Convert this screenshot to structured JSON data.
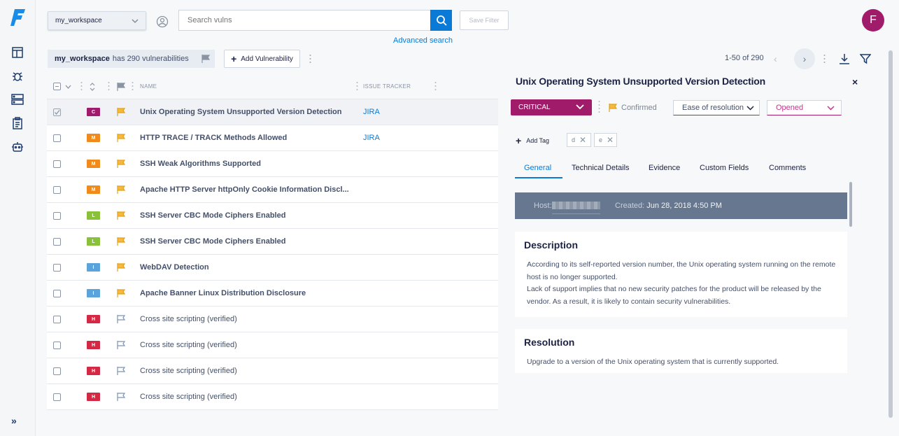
{
  "app": {
    "logo_letter": "F"
  },
  "nav": {
    "items": [
      "dashboard-icon",
      "bug-icon",
      "server-icon",
      "clipboard-icon",
      "robot-icon"
    ],
    "expand_label": "»"
  },
  "topbar": {
    "workspace": "my_workspace",
    "search_placeholder": "Search vulns",
    "save_filter": "Save Filter",
    "advanced_search": "Advanced search",
    "avatar_letter": "F"
  },
  "toolbar": {
    "workspace_name": "my_workspace",
    "count_text": "has 290 vulnerabilities",
    "add_vulnerability": "Add Vulnerability",
    "pager": "1-50 of 290"
  },
  "table": {
    "headers": {
      "name": "NAME",
      "issue_tracker": "ISSUE TRACKER"
    },
    "rows": [
      {
        "sev": "C",
        "name": "Unix Operating System Unsupported Version Detection",
        "issue": "JIRA",
        "confirmed": true,
        "bold": true
      },
      {
        "sev": "M",
        "name": "HTTP TRACE / TRACK Methods Allowed",
        "issue": "JIRA",
        "confirmed": true,
        "bold": true
      },
      {
        "sev": "M",
        "name": "SSH Weak Algorithms Supported",
        "issue": "",
        "confirmed": true,
        "bold": true
      },
      {
        "sev": "M",
        "name": "Apache HTTP Server httpOnly Cookie Information Discl...",
        "issue": "",
        "confirmed": true,
        "bold": true
      },
      {
        "sev": "L",
        "name": "SSH Server CBC Mode Ciphers Enabled",
        "issue": "",
        "confirmed": true,
        "bold": true
      },
      {
        "sev": "L",
        "name": "SSH Server CBC Mode Ciphers Enabled",
        "issue": "",
        "confirmed": true,
        "bold": true
      },
      {
        "sev": "I",
        "name": "WebDAV Detection",
        "issue": "",
        "confirmed": true,
        "bold": true
      },
      {
        "sev": "I",
        "name": "Apache Banner Linux Distribution Disclosure",
        "issue": "",
        "confirmed": true,
        "bold": true
      },
      {
        "sev": "H",
        "name": "Cross site scripting (verified)",
        "issue": "",
        "confirmed": false,
        "bold": false
      },
      {
        "sev": "H",
        "name": "Cross site scripting (verified)",
        "issue": "",
        "confirmed": false,
        "bold": false
      },
      {
        "sev": "H",
        "name": "Cross site scripting (verified)",
        "issue": "",
        "confirmed": false,
        "bold": false
      },
      {
        "sev": "H",
        "name": "Cross site scripting (verified)",
        "issue": "",
        "confirmed": false,
        "bold": false
      }
    ]
  },
  "severity_colors": {
    "C": "#a01c6a",
    "H": "#d32945",
    "M": "#f08a1c",
    "L": "#89c23a",
    "I": "#5aa3db"
  },
  "detail": {
    "title": "Unix Operating System Unsupported Version Detection",
    "close": "×",
    "severity": "CRITICAL",
    "confirmed": "Confirmed",
    "ease": "Ease of resolution",
    "status": "Opened",
    "add_tag": "Add Tag",
    "tags": [
      "d",
      "e"
    ],
    "tabs": [
      "General",
      "Technical Details",
      "Evidence",
      "Custom Fields",
      "Comments"
    ],
    "host_label": "Host:",
    "created_label": "Created:",
    "created_value": "Jun 28, 2018 4:50 PM",
    "description_title": "Description",
    "description_lines": [
      "According to its self-reported version number, the Unix operating system running on the remote",
      "host is no longer supported.",
      "Lack of support implies that no new security patches for the product will be released by the",
      "vendor. As a result, it is likely to contain security vulnerabilities."
    ],
    "resolution_title": "Resolution",
    "resolution_text": "Upgrade to a version of the Unix operating system that is currently supported."
  }
}
